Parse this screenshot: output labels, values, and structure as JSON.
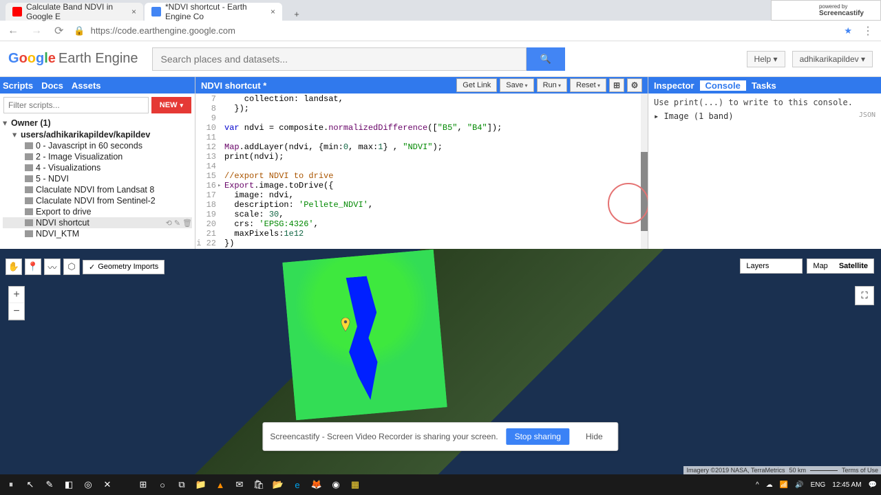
{
  "browser": {
    "tabs": [
      {
        "title": "Calculate Band NDVI in Google E"
      },
      {
        "title": "*NDVI shortcut - Earth Engine Co"
      }
    ],
    "url": "https://code.earthengine.google.com"
  },
  "watermark": {
    "prefix": "powered by",
    "brand": "Screencastify"
  },
  "gee_header": {
    "logo_text": "Earth Engine",
    "search_placeholder": "Search places and datasets...",
    "help": "Help",
    "user": "adhikarikapildev"
  },
  "left_panel": {
    "tabs": [
      "Scripts",
      "Docs",
      "Assets"
    ],
    "filter_placeholder": "Filter scripts...",
    "new_label": "NEW",
    "tree": {
      "owner": "Owner  (1)",
      "repo": "users/adhikarikapildev/kapildev",
      "scripts": [
        "0 - Javascript in 60 seconds",
        "2 - Image Visualization",
        "4 - Visualizations",
        "5 - NDVI",
        "Claculate NDVI from Landsat 8",
        "Claculate NDVI from Sentinel-2",
        "Export to drive",
        "NDVI shortcut",
        "NDVI_KTM"
      ]
    }
  },
  "editor": {
    "title": "NDVI shortcut *",
    "actions": {
      "get_link": "Get Link",
      "save": "Save",
      "run": "Run",
      "reset": "Reset"
    },
    "line_start": 7,
    "lines": [
      {
        "n": 7,
        "html": "    collection: landsat,"
      },
      {
        "n": 8,
        "html": "  });"
      },
      {
        "n": 9,
        "html": ""
      },
      {
        "n": 10,
        "html": "<span class='kw'>var</span> ndvi = composite.<span class='pr'>normalizedDifference</span>([<span class='str'>\"B5\"</span>, <span class='str'>\"B4\"</span>]);"
      },
      {
        "n": 11,
        "html": ""
      },
      {
        "n": 12,
        "html": "<span class='pr'>Map</span>.addLayer(ndvi, {min:<span class='num'>0</span>, max:<span class='num'>1</span>} , <span class='str'>\"NDVI\"</span>);"
      },
      {
        "n": 13,
        "html": "print(ndvi);"
      },
      {
        "n": 14,
        "html": ""
      },
      {
        "n": 15,
        "html": "<span class='cm'>//export NDVI to drive</span>"
      },
      {
        "n": 16,
        "html": "<span class='pr'>Export</span>.image.toDrive({",
        "fold": true
      },
      {
        "n": 17,
        "html": "  image: ndvi,"
      },
      {
        "n": 18,
        "html": "  description: <span class='str'>'Pellete_NDVI'</span>,"
      },
      {
        "n": 19,
        "html": "  scale: <span class='num'>30</span>,"
      },
      {
        "n": 20,
        "html": "  crs: <span class='str'>'EPSG:4326'</span>,"
      },
      {
        "n": 21,
        "html": "  maxPixels:<span class='num'>1e12</span>"
      },
      {
        "n": 22,
        "html": "})",
        "info": true
      }
    ]
  },
  "console": {
    "tabs": [
      "Inspector",
      "Console",
      "Tasks"
    ],
    "hint": "Use print(...) to write to this console.",
    "item": "Image (1 band)",
    "json": "JSON"
  },
  "map": {
    "geometry_imports": "Geometry Imports",
    "layers": "Layers",
    "map_label": "Map",
    "sat_label": "Satellite",
    "attribution": "Imagery ©2019 NASA, TerraMetrics",
    "scale": "50 km",
    "terms": "Terms of Use"
  },
  "share_banner": {
    "text": "Screencastify - Screen Video Recorder is sharing your screen.",
    "stop": "Stop sharing",
    "hide": "Hide"
  },
  "taskbar": {
    "lang": "ENG",
    "time": "12:45 AM"
  }
}
